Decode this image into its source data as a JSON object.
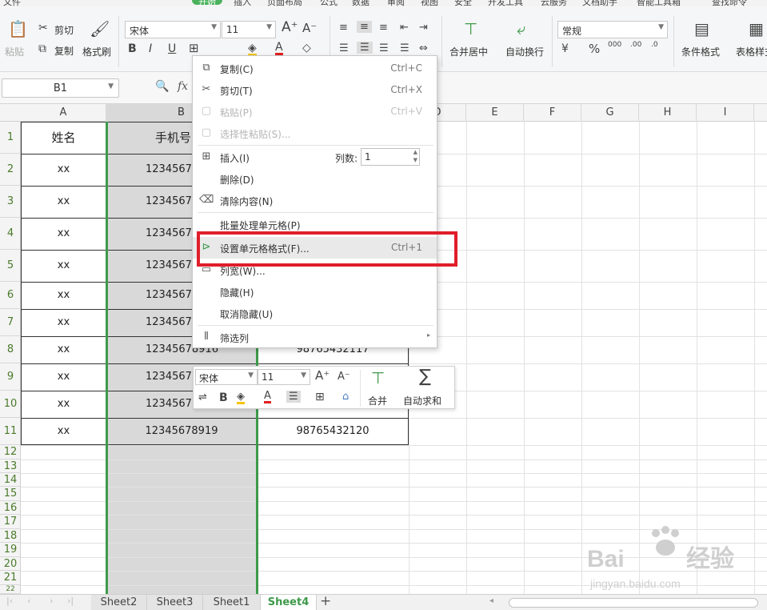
{
  "menubar": {
    "items": [
      "文件",
      "开始",
      "插入",
      "页面布局",
      "公式",
      "数据",
      "审阅",
      "视图",
      "安全",
      "开发工具",
      "云服务",
      "文档助手",
      "智能工具箱"
    ],
    "active": "开始",
    "search": "查找命令"
  },
  "ribbon": {
    "paste_label": "粘贴",
    "cut_label": "剪切",
    "copy_label": "复制",
    "format_painter_label": "格式刷",
    "font_name": "宋体",
    "font_size": "11",
    "merge_center_label": "合并居中",
    "wrap_text_label": "自动换行",
    "number_format": "常规",
    "conditional_format_label": "条件格式",
    "table_style_label": "表格样式"
  },
  "formula_bar": {
    "name_box": "B1",
    "fx_label": "fx"
  },
  "columns": [
    "A",
    "B",
    "",
    "D",
    "E",
    "F",
    "G",
    "H",
    "I"
  ],
  "rows": [
    "1",
    "2",
    "3",
    "4",
    "5",
    "6",
    "7",
    "8",
    "9",
    "10",
    "11",
    "12",
    "13",
    "14",
    "15",
    "16",
    "17",
    "18",
    "19",
    "20",
    "21",
    "22"
  ],
  "table": {
    "header_name": "姓名",
    "header_phone": "手机号",
    "names": [
      "xx",
      "xx",
      "xx",
      "xx",
      "xx",
      "xx",
      "xx",
      "xx",
      "xx",
      "xx"
    ],
    "phones": [
      "1234567",
      "1234567",
      "1234567",
      "1234567",
      "1234567",
      "1234567",
      "12345678916",
      "1234567",
      "1234567",
      "12345678919"
    ],
    "col_c_visible": [
      "98765432117",
      "98765432120"
    ]
  },
  "context_menu": {
    "copy": "复制(C)",
    "copy_sc": "Ctrl+C",
    "cut": "剪切(T)",
    "cut_sc": "Ctrl+X",
    "paste": "粘贴(P)",
    "paste_sc": "Ctrl+V",
    "paste_special": "选择性粘贴(S)...",
    "insert": "插入(I)",
    "col_count_label": "列数:",
    "col_count_value": "1",
    "delete": "删除(D)",
    "clear": "清除内容(N)",
    "batch": "批量处理单元格(P)",
    "format_cells": "设置单元格格式(F)...",
    "format_cells_sc": "Ctrl+1",
    "col_width": "列宽(W)...",
    "hide": "隐藏(H)",
    "unhide": "取消隐藏(U)",
    "filter": "筛选列"
  },
  "mini_toolbar": {
    "font_name": "宋体",
    "font_size": "11",
    "merge_label": "合并",
    "autosum_label": "自动求和"
  },
  "sheets": [
    "Sheet2",
    "Sheet3",
    "Sheet1",
    "Sheet4"
  ],
  "active_sheet": "Sheet4",
  "colors": {
    "accent_green": "#3e9a4a",
    "highlight_red": "#e01e2a"
  }
}
